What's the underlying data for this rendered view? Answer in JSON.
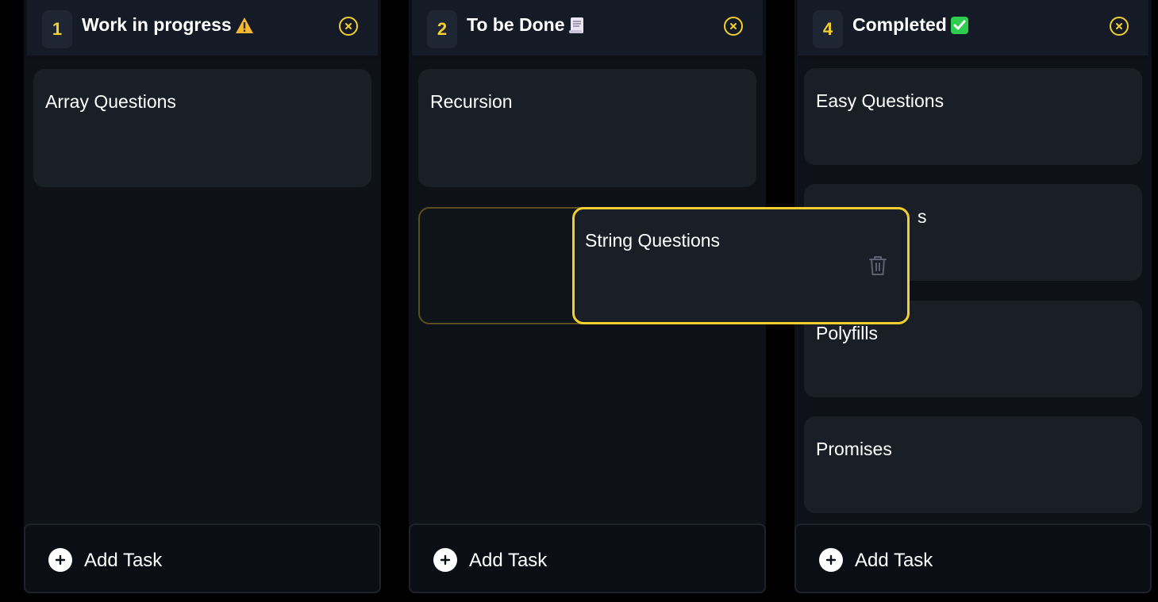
{
  "columns": [
    {
      "count": "1",
      "title": "Work in progress",
      "emoji": "warning-icon",
      "cards": [
        "Array Questions"
      ],
      "add_label": "Add Task"
    },
    {
      "count": "2",
      "title": "To be Done",
      "emoji": "scroll-icon",
      "cards": [
        "Recursion"
      ],
      "add_label": "Add Task"
    },
    {
      "count": "4",
      "title": "Completed",
      "emoji": "check-mark-icon",
      "cards": [
        "Easy Questions",
        "s",
        "Polyfills",
        "Promises"
      ],
      "add_label": "Add Task"
    }
  ],
  "dragging_card": {
    "text": "String Questions"
  },
  "colors": {
    "accent": "#f2cf2e",
    "background": "#000000",
    "column": "#0e1118",
    "card": "#1a1e26"
  }
}
